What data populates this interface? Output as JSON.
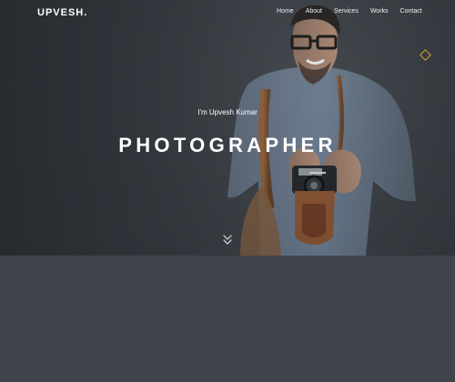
{
  "header": {
    "logo": "UPVESH."
  },
  "nav": {
    "items": [
      {
        "label": "Home"
      },
      {
        "label": "About"
      },
      {
        "label": "Services"
      },
      {
        "label": "Works"
      },
      {
        "label": "Contact"
      }
    ]
  },
  "hero": {
    "subtitle": "I'm Upvesh Kumar",
    "title": "PHOTOGRAPHER"
  },
  "colors": {
    "background": "#40454c",
    "hero_overlay": "#353a40",
    "accent": "#d7a02d",
    "text": "#ffffff"
  },
  "icons": {
    "decorative": "diamond-icon",
    "scroll": "double-chevron-down-icon"
  }
}
